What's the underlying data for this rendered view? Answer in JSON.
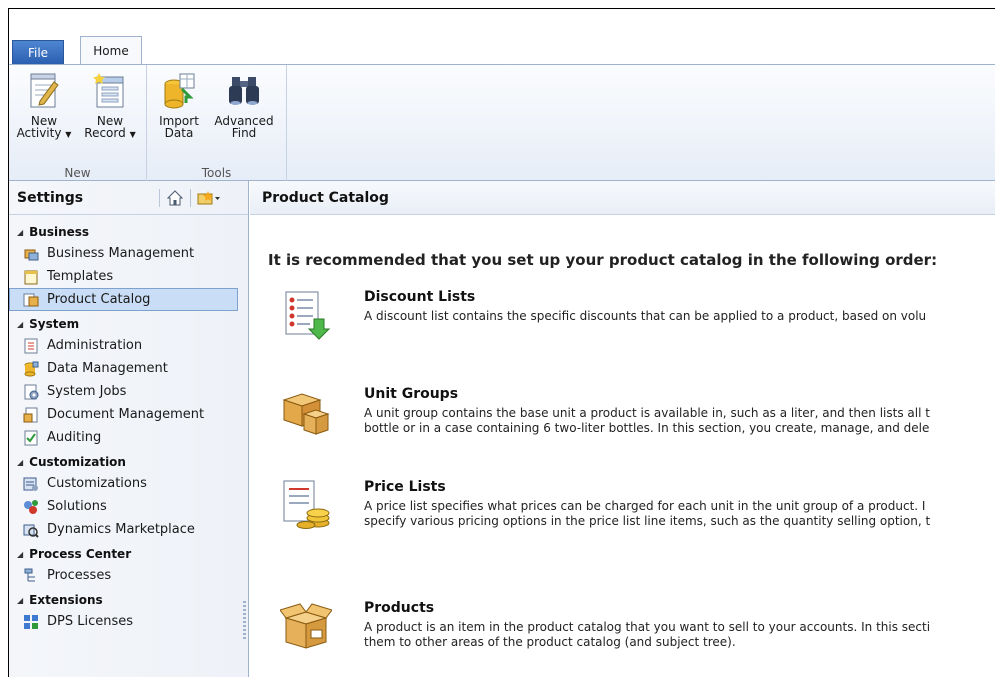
{
  "ribbon": {
    "tabs": {
      "file": "File",
      "home": "Home"
    },
    "groups": {
      "new": {
        "label": "New",
        "new_activity": {
          "line1": "New",
          "line2": "Activity"
        },
        "new_record": {
          "line1": "New",
          "line2": "Record"
        }
      },
      "tools": {
        "label": "Tools",
        "import_data": {
          "line1": "Import",
          "line2": "Data"
        },
        "advanced_find": {
          "line1": "Advanced",
          "line2": "Find"
        }
      }
    }
  },
  "nav": {
    "title": "Settings",
    "sections": {
      "business": {
        "label": "Business",
        "items": [
          "Business Management",
          "Templates",
          "Product Catalog"
        ]
      },
      "system": {
        "label": "System",
        "items": [
          "Administration",
          "Data Management",
          "System Jobs",
          "Document Management",
          "Auditing"
        ]
      },
      "customization": {
        "label": "Customization",
        "items": [
          "Customizations",
          "Solutions",
          "Dynamics Marketplace"
        ]
      },
      "process_center": {
        "label": "Process Center",
        "items": [
          "Processes"
        ]
      },
      "extensions": {
        "label": "Extensions",
        "items": [
          "DPS Licenses"
        ]
      }
    }
  },
  "main": {
    "title": "Product Catalog",
    "intro": "It is recommended that you set up your product catalog in the following order:",
    "entries": [
      {
        "title": "Discount Lists",
        "line1": "A discount list contains the specific discounts that can be applied to a product, based on volu",
        "line2": ""
      },
      {
        "title": "Unit Groups",
        "line1": "A unit group contains the base unit a product is available in, such as a liter, and then lists all t",
        "line2": "bottle or in a case containing 6 two-liter bottles. In this section, you create, manage, and dele"
      },
      {
        "title": "Price Lists",
        "line1": "A price list specifies what prices can be charged for each unit in the unit group of a product. I",
        "line2": "specify various pricing options in the price list line items, such as the quantity selling option, t"
      },
      {
        "title": "Products",
        "line1": "A product is an item in the product catalog that you want to sell to your accounts. In this secti",
        "line2": "them to other areas of the product catalog (and subject tree)."
      }
    ]
  },
  "colors": {
    "file_tab": "#2a5fb0",
    "selection": "#c9ddf6",
    "border": "#9fb3cf"
  }
}
